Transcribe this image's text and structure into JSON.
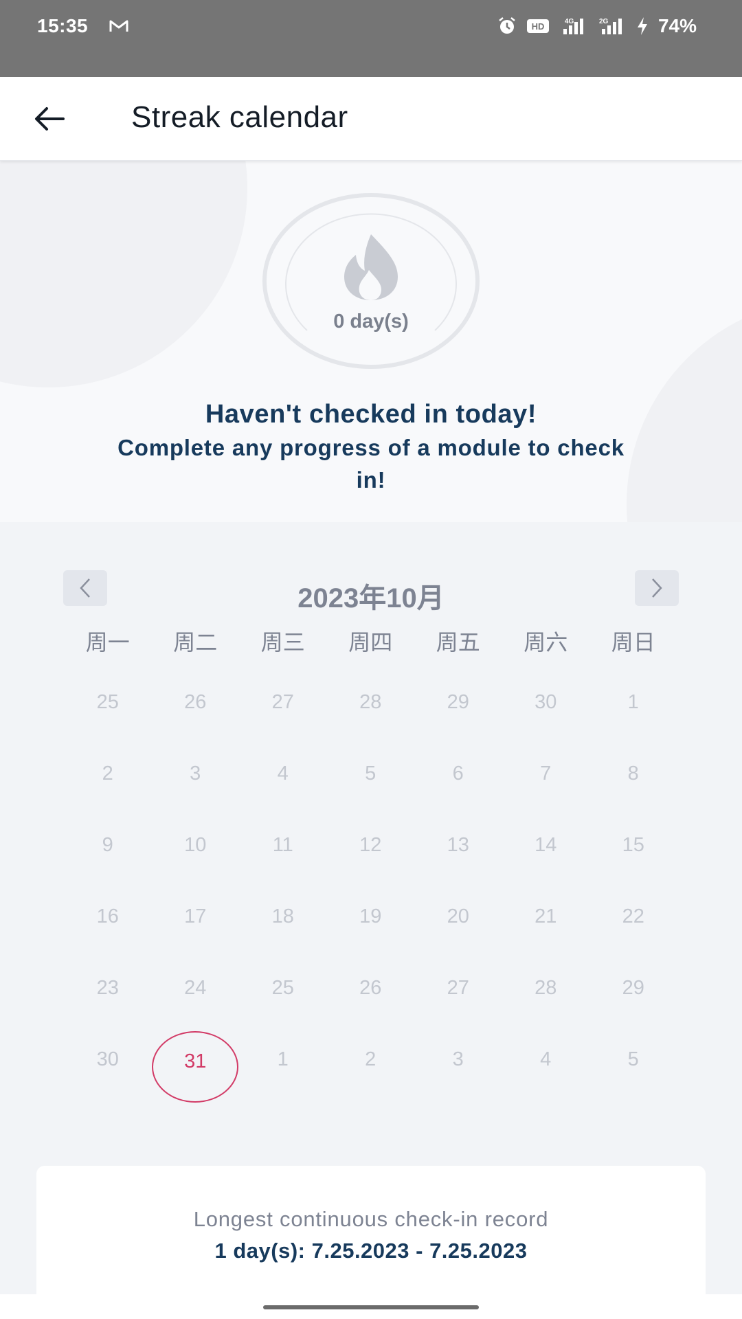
{
  "status_bar": {
    "time": "15:35",
    "icons": [
      "gmail-icon",
      "alarm-icon",
      "hd-icon",
      "signal-4g-icon",
      "signal-2g-icon",
      "charging-icon"
    ],
    "hd_label": "HD",
    "battery": "74%"
  },
  "app_bar": {
    "title": "Streak calendar",
    "back_icon": "arrow-left-icon"
  },
  "streak": {
    "count": "0 day(s)",
    "icon": "flame-icon",
    "message": "Haven't checked in today!",
    "sub_message": "Complete any progress of a module to check in!"
  },
  "calendar": {
    "month_label": "2023年10月",
    "prev_icon": "chevron-left-icon",
    "next_icon": "chevron-right-icon",
    "weekdays": [
      "周一",
      "周二",
      "周三",
      "周四",
      "周五",
      "周六",
      "周日"
    ],
    "weeks": [
      [
        "25",
        "26",
        "27",
        "28",
        "29",
        "30",
        "1"
      ],
      [
        "2",
        "3",
        "4",
        "5",
        "6",
        "7",
        "8"
      ],
      [
        "9",
        "10",
        "11",
        "12",
        "13",
        "14",
        "15"
      ],
      [
        "16",
        "17",
        "18",
        "19",
        "20",
        "21",
        "22"
      ],
      [
        "23",
        "24",
        "25",
        "26",
        "27",
        "28",
        "29"
      ],
      [
        "30",
        "31",
        "1",
        "2",
        "3",
        "4",
        "5"
      ]
    ],
    "today": "31",
    "colors": {
      "today_accent": "#d23a66",
      "inactive_day": "#c3c7cf"
    }
  },
  "record": {
    "label": "Longest continuous check-in record",
    "value": "1 day(s): 7.25.2023 - 7.25.2023"
  }
}
